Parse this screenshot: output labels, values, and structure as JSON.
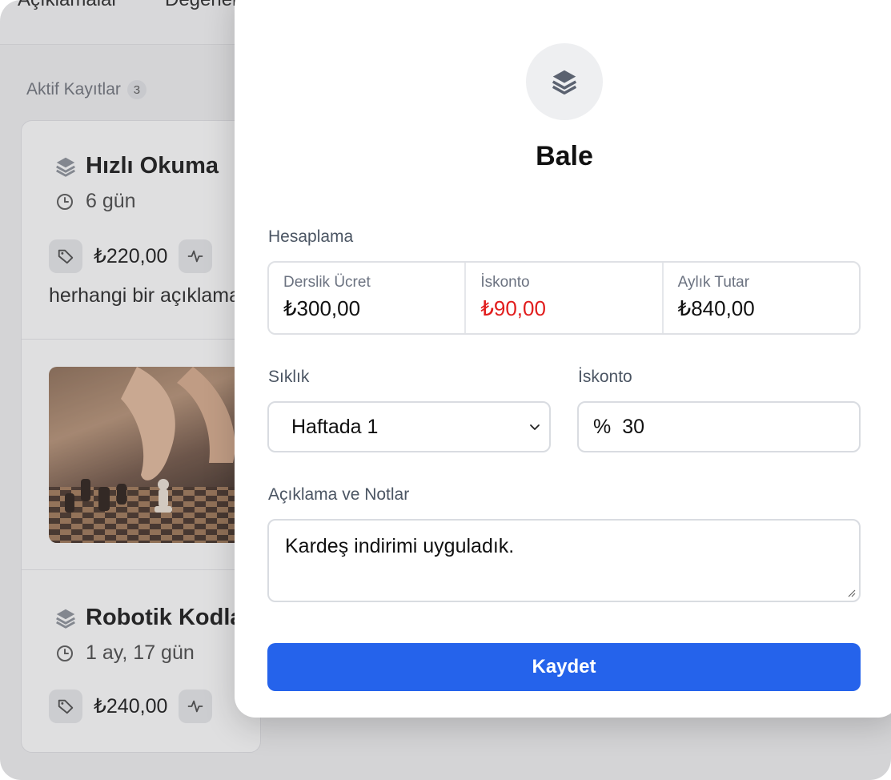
{
  "background": {
    "tabs": [
      "Açıklamalar",
      "Değerlendirme"
    ],
    "section_title": "Aktif Kayıtlar",
    "section_count": "3",
    "cards": [
      {
        "title": "Hızlı Okuma",
        "duration": "6 gün",
        "price": "₺220,00",
        "description": "herhangi bir açıklama"
      },
      {
        "title": "Robotik Kodlama",
        "duration": "1 ay, 17 gün",
        "price": "₺240,00"
      }
    ]
  },
  "modal": {
    "title": "Bale",
    "calc_label": "Hesaplama",
    "calc": {
      "fee_label": "Derslik Ücret",
      "fee_value": "₺300,00",
      "discount_label": "İskonto",
      "discount_value": "₺90,00",
      "monthly_label": "Aylık Tutar",
      "monthly_value": "₺840,00"
    },
    "frequency_label": "Sıklık",
    "frequency_value": "Haftada 1",
    "discount_field_label": "İskonto",
    "discount_prefix": "%",
    "discount_input_value": "30",
    "notes_label": "Açıklama ve Notlar",
    "notes_value": "Kardeş indirimi uyguladık.",
    "save_label": "Kaydet"
  },
  "colors": {
    "primary": "#2563eb",
    "negative": "#e11d1d"
  },
  "icons": {
    "modal_icon": "layers-icon",
    "card_icon": "layers-icon",
    "clock": "clock-icon",
    "price": "tag-icon",
    "activity": "activity-icon",
    "select": "chevron-down-icon"
  }
}
